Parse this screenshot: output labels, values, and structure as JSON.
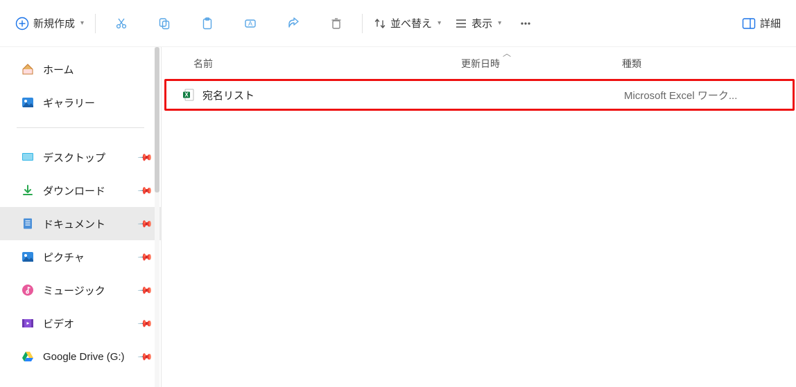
{
  "toolbar": {
    "new_label": "新規作成",
    "sort_label": "並べ替え",
    "view_label": "表示",
    "detail_label": "詳細"
  },
  "sidebar": {
    "home": "ホーム",
    "gallery": "ギャラリー",
    "items": [
      {
        "label": "デスクトップ",
        "icon": "desktop"
      },
      {
        "label": "ダウンロード",
        "icon": "download"
      },
      {
        "label": "ドキュメント",
        "icon": "document",
        "selected": true
      },
      {
        "label": "ピクチャ",
        "icon": "pictures"
      },
      {
        "label": "ミュージック",
        "icon": "music"
      },
      {
        "label": "ビデオ",
        "icon": "video"
      },
      {
        "label": "Google Drive (G:)",
        "icon": "gdrive"
      }
    ]
  },
  "columns": {
    "name": "名前",
    "date": "更新日時",
    "type": "種類"
  },
  "files": [
    {
      "name": "宛名リスト",
      "date": "",
      "type": "Microsoft Excel ワーク..."
    }
  ]
}
